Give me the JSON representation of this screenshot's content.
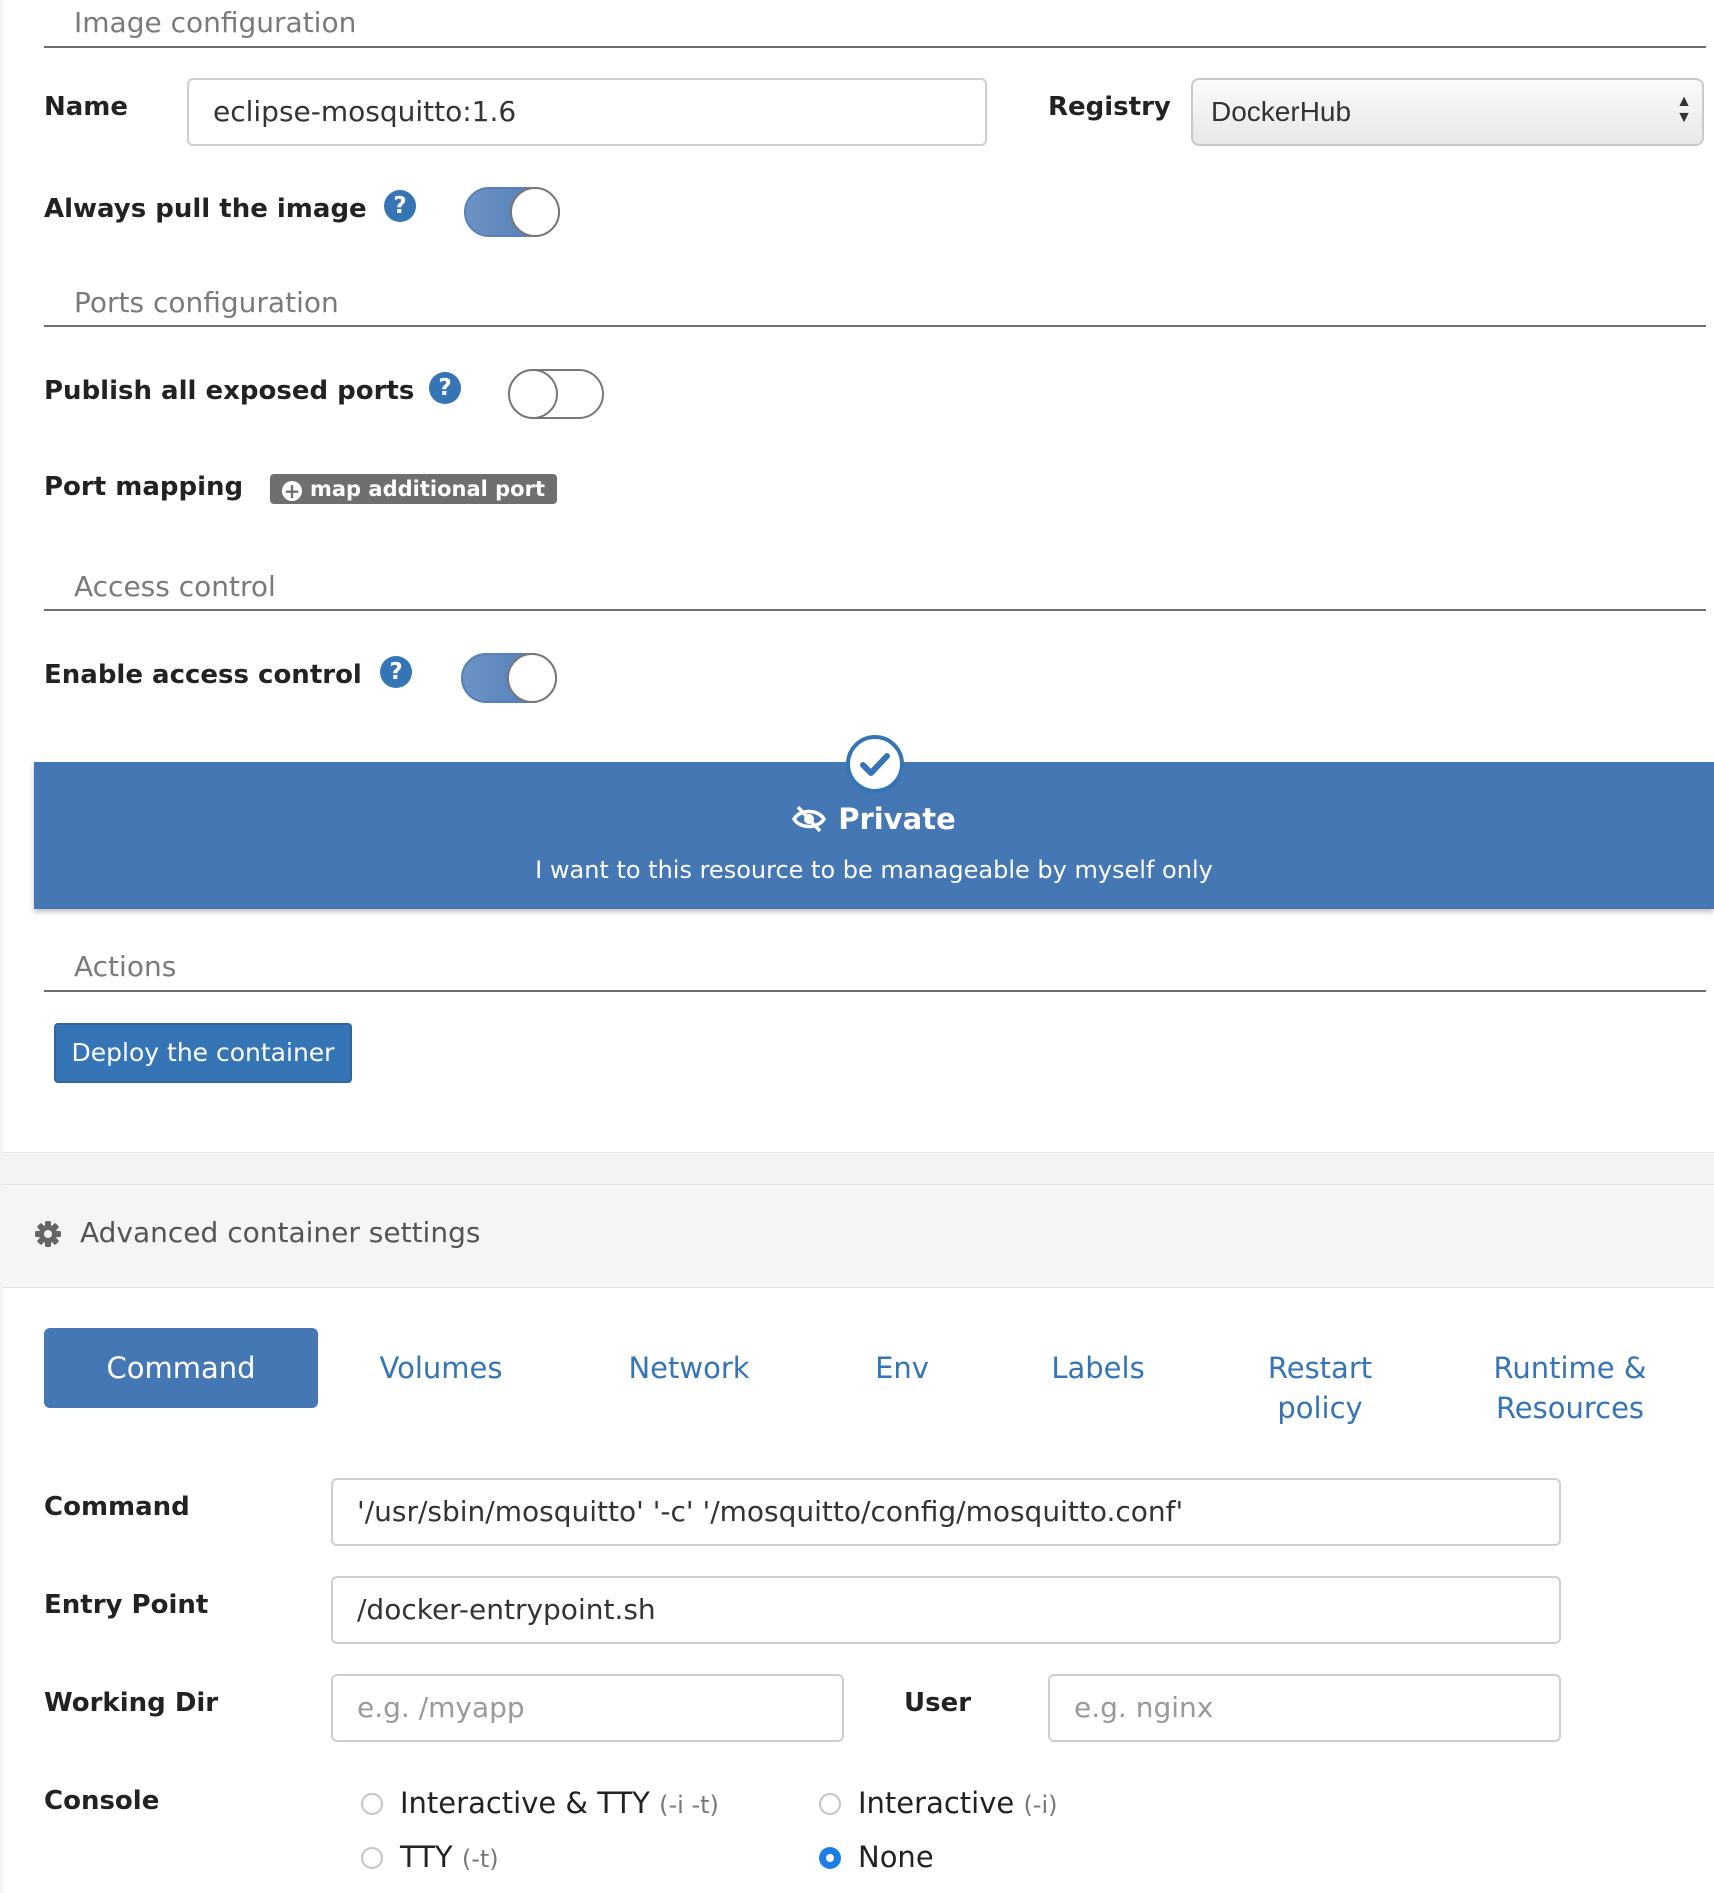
{
  "image_config": {
    "section_title": "Image configuration",
    "name_label": "Name",
    "name_value": "eclipse-mosquitto:1.6",
    "registry_label": "Registry",
    "registry_value": "DockerHub",
    "always_pull_label": "Always pull the image",
    "always_pull_on": true
  },
  "ports_config": {
    "section_title": "Ports configuration",
    "publish_all_label": "Publish all exposed ports",
    "publish_all_on": false,
    "port_mapping_label": "Port mapping",
    "map_port_button": "map additional port"
  },
  "access_control": {
    "section_title": "Access control",
    "enable_label": "Enable access control",
    "enable_on": true,
    "private_title": "Private",
    "private_description": "I want to this resource to be manageable by myself only"
  },
  "actions": {
    "section_title": "Actions",
    "deploy_button": "Deploy the container"
  },
  "advanced": {
    "title": "Advanced container settings",
    "tabs": [
      "Command",
      "Volumes",
      "Network",
      "Env",
      "Labels",
      "Restart policy",
      "Runtime & Resources"
    ],
    "active_tab": "Command"
  },
  "command_tab": {
    "command_label": "Command",
    "command_value": "'/usr/sbin/mosquitto' '-c' '/mosquitto/config/mosquitto.conf'",
    "entry_point_label": "Entry Point",
    "entry_point_value": "/docker-entrypoint.sh",
    "working_dir_label": "Working Dir",
    "working_dir_placeholder": "e.g. /myapp",
    "user_label": "User",
    "user_placeholder": "e.g. nginx",
    "console_label": "Console",
    "console_options": [
      {
        "label": "Interactive & TTY",
        "flag": "(-i -t)",
        "checked": false
      },
      {
        "label": "Interactive",
        "flag": "(-i)",
        "checked": false
      },
      {
        "label": "TTY",
        "flag": "(-t)",
        "checked": false
      },
      {
        "label": "None",
        "flag": "",
        "checked": true
      }
    ]
  },
  "colors": {
    "primary": "#3574b5",
    "private_box": "#4577b4",
    "radio_checked": "#1c7fe8"
  },
  "icons": {
    "help": "question-circle-icon",
    "plus": "plus-circle-icon",
    "eye_slash": "eye-slash-icon",
    "check": "check-circle-icon",
    "gear": "gear-icon"
  }
}
